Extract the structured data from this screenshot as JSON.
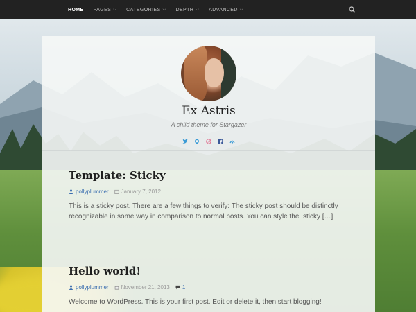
{
  "nav": {
    "items": [
      {
        "label": "HOME",
        "active": true,
        "has_caret": false
      },
      {
        "label": "PAGES",
        "active": false,
        "has_caret": true
      },
      {
        "label": "CATEGORIES",
        "active": false,
        "has_caret": true
      },
      {
        "label": "DEPTH",
        "active": false,
        "has_caret": true
      },
      {
        "label": "ADVANCED",
        "active": false,
        "has_caret": true
      }
    ],
    "search_icon": "search-icon"
  },
  "site": {
    "title": "Ex Astris",
    "description": "A child theme for Stargazer",
    "social_icons": [
      "twitter-icon",
      "github-icon",
      "dribbble-icon",
      "facebook-icon",
      "delicious-icon"
    ]
  },
  "posts": [
    {
      "title": "Template: Sticky",
      "author": "pollyplummer",
      "date": "January 7, 2012",
      "comments": "",
      "excerpt": "This is a sticky post. There are a few things to verify: The sticky post should be distinctly recognizable in some way in comparison to normal posts. You can style the .sticky […]"
    },
    {
      "title": "Hello world!",
      "author": "pollyplummer",
      "date": "November 21, 2013",
      "comments": "1",
      "excerpt": "Welcome to WordPress. This is your first post. Edit or delete it, then start blogging!"
    }
  ],
  "colors": {
    "nav_bg": "#222222",
    "link": "#3d6fb0",
    "social": "#3b9bd6"
  }
}
